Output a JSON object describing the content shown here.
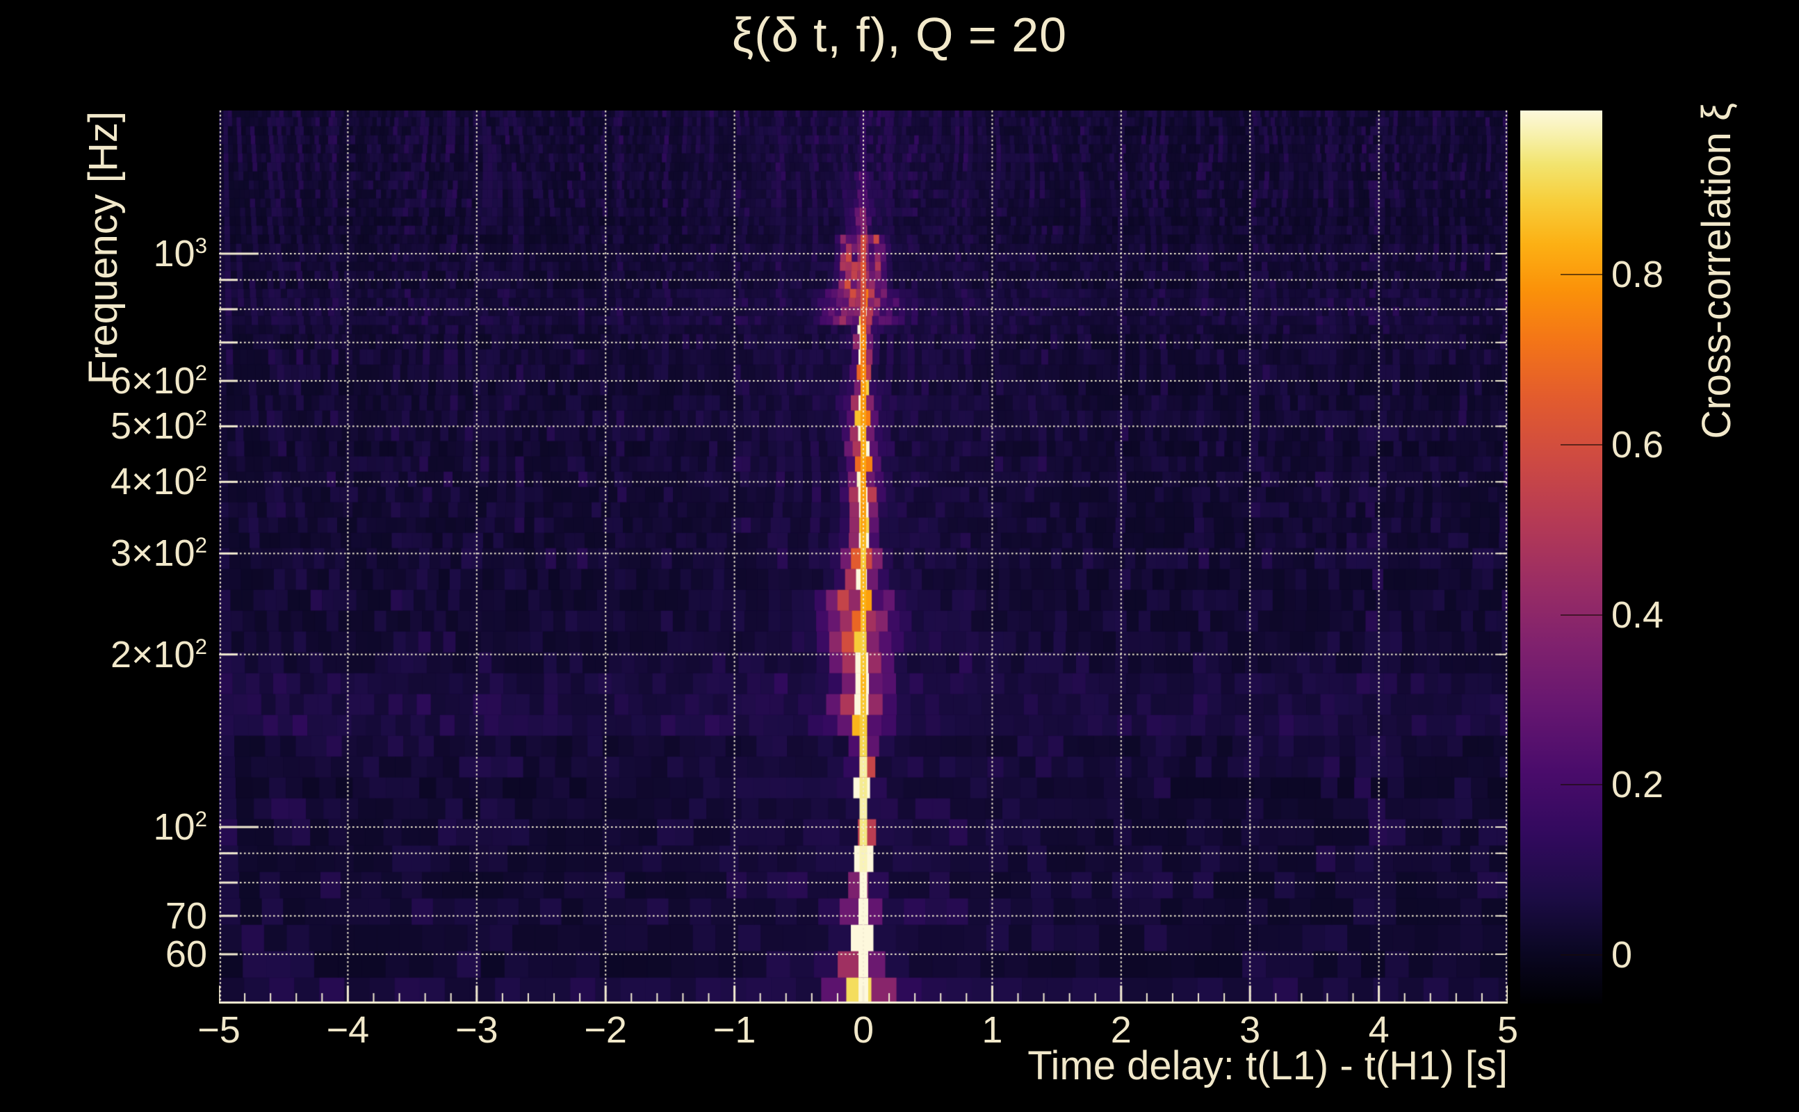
{
  "title": "ξ(δ t, f), Q = 20",
  "axes": {
    "x": {
      "label": "Time delay: t(L1) - t(H1) [s]",
      "min": -5,
      "max": 5,
      "major_ticks": [
        -5,
        -4,
        -3,
        -2,
        -1,
        0,
        1,
        2,
        3,
        4,
        5
      ],
      "tick_labels": [
        "−5",
        "−4",
        "−3",
        "−2",
        "−1",
        "0",
        "1",
        "2",
        "3",
        "4",
        "5"
      ],
      "minor_step": 0.2,
      "gridlines": [
        -4,
        -3,
        -2,
        -1,
        0,
        1,
        2,
        3,
        4
      ]
    },
    "y": {
      "label": "Frequency [Hz]",
      "scale": "log",
      "min_hz": 49,
      "max_hz": 1780,
      "gridline_freqs": [
        1000,
        900,
        800,
        700,
        600,
        500,
        400,
        300,
        200,
        100,
        90,
        80,
        70,
        60
      ],
      "labeled_ticks": [
        {
          "f": 1000,
          "base": "10",
          "sup": "3"
        },
        {
          "f": 600,
          "base": "6×10",
          "sup": "2"
        },
        {
          "f": 500,
          "base": "5×10",
          "sup": "2"
        },
        {
          "f": 400,
          "base": "4×10",
          "sup": "2"
        },
        {
          "f": 300,
          "base": "3×10",
          "sup": "2"
        },
        {
          "f": 200,
          "base": "2×10",
          "sup": "2"
        },
        {
          "f": 100,
          "base": "10",
          "sup": "2"
        },
        {
          "f": 70,
          "base": "70",
          "sup": ""
        },
        {
          "f": 60,
          "base": "60",
          "sup": ""
        }
      ]
    }
  },
  "colorbar": {
    "label": "Cross-correlation ξ",
    "min": -0.057,
    "max": 0.993,
    "ticks": [
      0.8,
      0.6,
      0.4,
      0.2,
      0
    ],
    "tick_labels": [
      "0.8",
      "0.6",
      "0.4",
      "0.2",
      "0"
    ],
    "gradient": [
      [
        "#000003",
        0
      ],
      [
        "#0b0724",
        0.06
      ],
      [
        "#1c0c45",
        0.12
      ],
      [
        "#320a5e",
        0.19
      ],
      [
        "#4a0c6b",
        0.26
      ],
      [
        "#651670",
        0.33
      ],
      [
        "#7f216e",
        0.4
      ],
      [
        "#9a2d64",
        0.47
      ],
      [
        "#b53a55",
        0.54
      ],
      [
        "#ce4a42",
        0.61
      ],
      [
        "#e35c2d",
        0.68
      ],
      [
        "#f37418",
        0.74
      ],
      [
        "#fb9209",
        0.8
      ],
      [
        "#fcb014",
        0.85
      ],
      [
        "#f7cf3c",
        0.9
      ],
      [
        "#f2e46f",
        0.94
      ],
      [
        "#f7f0a8",
        0.97
      ],
      [
        "#fdf8dc",
        1.0
      ]
    ]
  },
  "chart_data": {
    "type": "heatmap",
    "title": "ξ(δ t, f), Q = 20",
    "xlabel": "Time delay: t(L1) - t(H1) [s]",
    "ylabel": "Frequency [Hz]",
    "x_range_s": [
      -5,
      5
    ],
    "y_range_hz": [
      49,
      1780
    ],
    "y_scale": "log",
    "colormap": "inferno",
    "colorbar_label": "Cross-correlation ξ",
    "colorbar_range": [
      -0.057,
      0.993
    ],
    "colorbar_ticks": [
      0,
      0.2,
      0.4,
      0.6,
      0.8
    ],
    "grid": "dotted, horizontal at decade subdivisions 60-1000 Hz, vertical at integer seconds",
    "signal_summary": "Narrow bright ridge of high cross-correlation at time delay ≈ 0 s, strongest (ξ ≈ 1, white-yellow) at 50-70 Hz, continuously visible to ≈ 1100 Hz; blocky orange side-lobes out to ±0.35 s around 150-300 Hz; orange lobe clusters within ±0.2 s at 380-560 Hz; hollow ring-like double lobes at ±0.11 s near 860-1060 Hz; wide faint band at 760-860 Hz; faint purple broadening above 1100 Hz; background is dark purple noise ξ ≈ 0-0.1 with fine vertical streaks and a slightly brighter noise band at 140-185 Hz.",
    "ridge": {
      "delay_s": 0,
      "core_width_s": 0.05
    },
    "feature_key": [
      "f_lo_hz",
      "f_hi_hz",
      "core_peak_xi",
      "lobe_peak_xi",
      "lobe_sigma_s",
      "lobe_offset_s"
    ],
    "features": [
      [
        49,
        58,
        1.0,
        0.85,
        0.14,
        0
      ],
      [
        58,
        75,
        0.97,
        0.55,
        0.09,
        0
      ],
      [
        75,
        112,
        0.92,
        0.3,
        0.05,
        0
      ],
      [
        112,
        150,
        0.88,
        0.45,
        0.07,
        0
      ],
      [
        150,
        210,
        0.85,
        0.62,
        0.16,
        0
      ],
      [
        210,
        262,
        0.82,
        0.6,
        0.19,
        0
      ],
      [
        262,
        312,
        0.8,
        0.5,
        0.13,
        0
      ],
      [
        312,
        380,
        0.78,
        0.5,
        0.09,
        0
      ],
      [
        380,
        465,
        0.78,
        0.58,
        0.09,
        0
      ],
      [
        465,
        560,
        0.76,
        0.55,
        0.1,
        0
      ],
      [
        560,
        660,
        0.74,
        0.42,
        0.07,
        0
      ],
      [
        660,
        760,
        0.72,
        0.45,
        0.07,
        0
      ],
      [
        760,
        860,
        0.6,
        0.5,
        0.2,
        0
      ],
      [
        860,
        965,
        0.58,
        0.6,
        0.055,
        0.11
      ],
      [
        965,
        1065,
        0.55,
        0.52,
        0.055,
        0.11
      ],
      [
        1065,
        1200,
        0.33,
        0.22,
        0.1,
        0
      ],
      [
        1200,
        1400,
        0.18,
        0.12,
        0.15,
        0
      ],
      [
        1400,
        1790,
        0.1,
        0.06,
        0.22,
        0
      ]
    ],
    "noise": {
      "base_xi": 0.008,
      "speckle_xi": 0.045,
      "streak_xi": 0.05,
      "center_glow_xi": 0.022,
      "row_bands": [
        [
          140,
          185,
          0.022
        ],
        [
          750,
          860,
          0.015
        ],
        [
          49,
          53,
          0.02
        ]
      ]
    }
  }
}
